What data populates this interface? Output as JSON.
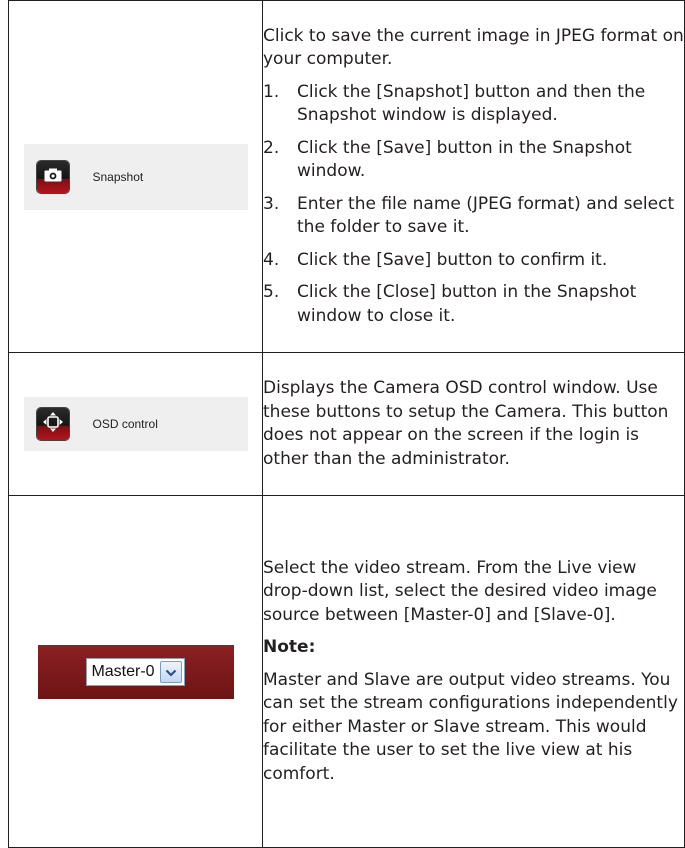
{
  "rows": [
    {
      "control": {
        "label": "Snapshot",
        "icon": "camera-icon"
      },
      "intro": "Click to save the current image in JPEG format on your computer.",
      "steps": [
        {
          "num": "1.",
          "text": "Click the [Snapshot] button and then the Snapshot window is displayed."
        },
        {
          "num": "2.",
          "text": "Click the [Save] button in the Snapshot window."
        },
        {
          "num": "3.",
          "text": "Enter the file name (JPEG format) and select the folder to save it."
        },
        {
          "num": "4.",
          "text": "Click the [Save] button to confirm it."
        },
        {
          "num": "5.",
          "text": "Click the [Close] button in the Snapshot window to close it."
        }
      ]
    },
    {
      "control": {
        "label": "OSD control",
        "icon": "osd-control-icon"
      },
      "description": "Displays the Camera OSD control window. Use these buttons to setup the Camera. This button does not appear on the screen if the login is other than the administrator."
    },
    {
      "control": {
        "selected": "Master-0",
        "icon": "chevron-down-icon"
      },
      "description": "Select the video stream. From the Live view drop-down list, select the desired video image source between [Master-0] and [Slave-0].",
      "note_label": "Note:",
      "note_text": "Master and Slave are output video streams. You can set the stream configurations independently for either Master or Slave stream. This would facilitate the user to set the live view at his comfort."
    }
  ],
  "colors": {
    "button_dark": "#151515",
    "button_red": "#b3141b",
    "stream_bar": "#7a1a1c",
    "strip_bg": "#efefef"
  }
}
